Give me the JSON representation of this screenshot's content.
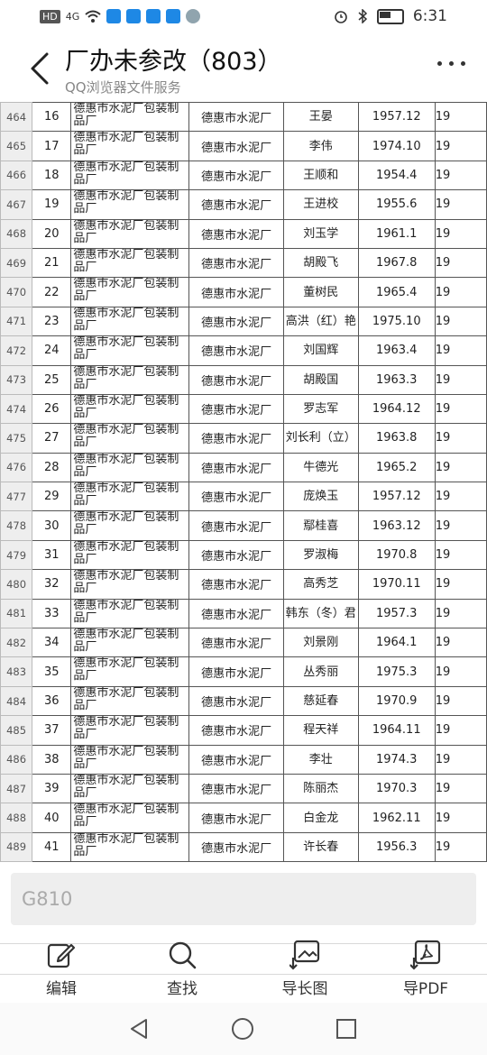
{
  "status_bar": {
    "time": "6:31",
    "network_label": "4G",
    "hd_label": "HD"
  },
  "header": {
    "title": "厂办未参改（803）",
    "subtitle": "QQ浏览器文件服务"
  },
  "sheet": {
    "unit_text": [
      "德惠市水泥厂包装制",
      "品厂"
    ],
    "factory": "德惠市水泥厂",
    "rows": [
      {
        "row": "464",
        "seq": "16",
        "name": "王晏",
        "date": "1957.12",
        "extra": "19"
      },
      {
        "row": "465",
        "seq": "17",
        "name": "李伟",
        "date": "1974.10",
        "extra": "19"
      },
      {
        "row": "466",
        "seq": "18",
        "name": "王顺和",
        "date": "1954.4",
        "extra": "19"
      },
      {
        "row": "467",
        "seq": "19",
        "name": "王进校",
        "date": "1955.6",
        "extra": "19"
      },
      {
        "row": "468",
        "seq": "20",
        "name": "刘玉学",
        "date": "1961.1",
        "extra": "19"
      },
      {
        "row": "469",
        "seq": "21",
        "name": "胡殿飞",
        "date": "1967.8",
        "extra": "19"
      },
      {
        "row": "470",
        "seq": "22",
        "name": "董树民",
        "date": "1965.4",
        "extra": "19"
      },
      {
        "row": "471",
        "seq": "23",
        "name": "高洪（红）艳",
        "date": "1975.10",
        "extra": "19"
      },
      {
        "row": "472",
        "seq": "24",
        "name": "刘国辉",
        "date": "1963.4",
        "extra": "19"
      },
      {
        "row": "473",
        "seq": "25",
        "name": "胡殿国",
        "date": "1963.3",
        "extra": "19"
      },
      {
        "row": "474",
        "seq": "26",
        "name": "罗志军",
        "date": "1964.12",
        "extra": "19"
      },
      {
        "row": "475",
        "seq": "27",
        "name": "刘长利（立）",
        "date": "1963.8",
        "extra": "19"
      },
      {
        "row": "476",
        "seq": "28",
        "name": "牛德光",
        "date": "1965.2",
        "extra": "19"
      },
      {
        "row": "477",
        "seq": "29",
        "name": "庞焕玉",
        "date": "1957.12",
        "extra": "19"
      },
      {
        "row": "478",
        "seq": "30",
        "name": "鄢桂喜",
        "date": "1963.12",
        "extra": "19"
      },
      {
        "row": "479",
        "seq": "31",
        "name": "罗淑梅",
        "date": "1970.8",
        "extra": "19"
      },
      {
        "row": "480",
        "seq": "32",
        "name": "高秀芝",
        "date": "1970.11",
        "extra": "19"
      },
      {
        "row": "481",
        "seq": "33",
        "name": "韩东（冬）君",
        "date": "1957.3",
        "extra": "19"
      },
      {
        "row": "482",
        "seq": "34",
        "name": "刘景刚",
        "date": "1964.1",
        "extra": "19"
      },
      {
        "row": "483",
        "seq": "35",
        "name": "丛秀丽",
        "date": "1975.3",
        "extra": "19"
      },
      {
        "row": "484",
        "seq": "36",
        "name": "慈延春",
        "date": "1970.9",
        "extra": "19"
      },
      {
        "row": "485",
        "seq": "37",
        "name": "程天祥",
        "date": "1964.11",
        "extra": "19"
      },
      {
        "row": "486",
        "seq": "38",
        "name": "李壮",
        "date": "1974.3",
        "extra": "19"
      },
      {
        "row": "487",
        "seq": "39",
        "name": "陈丽杰",
        "date": "1970.3",
        "extra": "19"
      },
      {
        "row": "488",
        "seq": "40",
        "name": "白金龙",
        "date": "1962.11",
        "extra": "19"
      },
      {
        "row": "489",
        "seq": "41",
        "name": "许长春",
        "date": "1956.3",
        "extra": "19"
      }
    ]
  },
  "search": {
    "placeholder": "G810"
  },
  "toolbar": {
    "edit_label": "编辑",
    "find_label": "查找",
    "long_image_label": "导长图",
    "pdf_label": "导PDF"
  }
}
